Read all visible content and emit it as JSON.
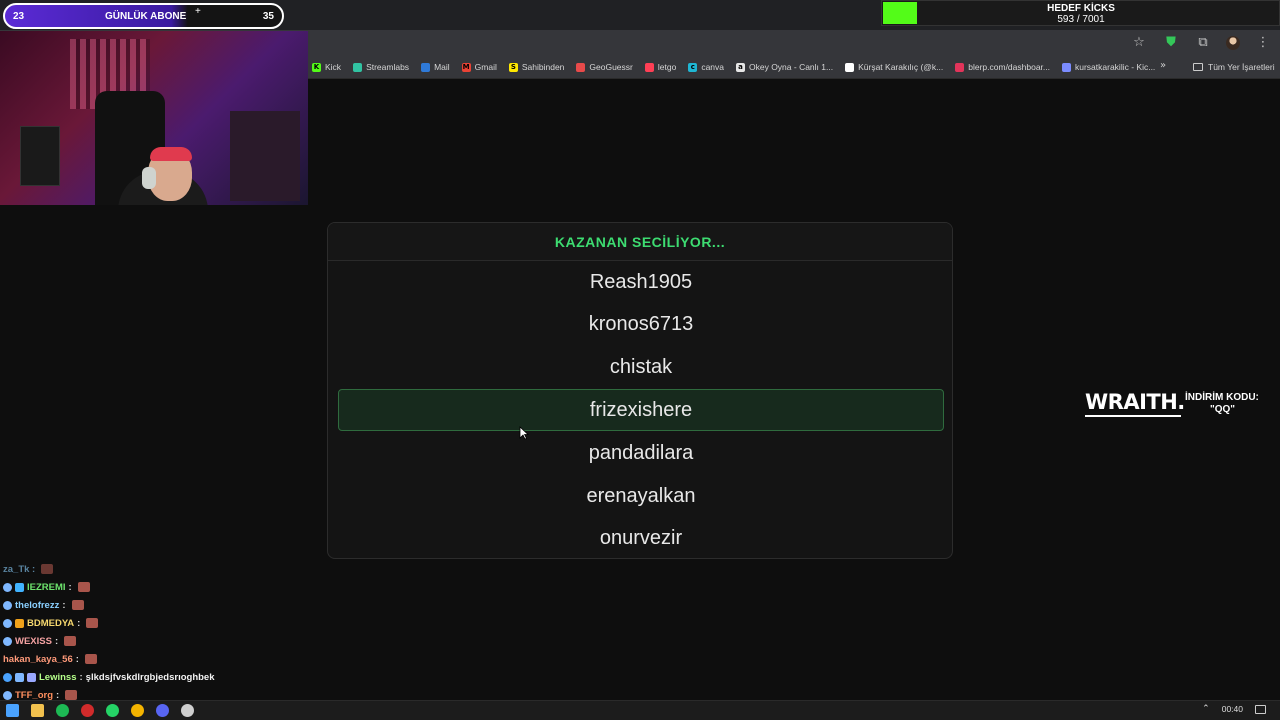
{
  "subscriber_bar": {
    "start": "23",
    "label": "GÜNLÜK ABONE",
    "plus": "+",
    "end": "35",
    "fill_fraction": 0.66
  },
  "kick_goal": {
    "title": "HEDEF KİCKS",
    "count": "593 / 7001",
    "progress_fraction": 0.0847,
    "bar_color": "#53fc18"
  },
  "bookmarks": {
    "items": [
      {
        "label": "Kick",
        "icon": "kick-icon",
        "color": "#53fc18",
        "glyph": "K"
      },
      {
        "label": "Streamlabs",
        "icon": "streamlabs-icon",
        "color": "#31c3a2",
        "glyph": ""
      },
      {
        "label": "Mail",
        "icon": "mail-icon",
        "color": "#2f7ad8",
        "glyph": ""
      },
      {
        "label": "Gmail",
        "icon": "gmail-icon",
        "color": "#ea4335",
        "glyph": "M"
      },
      {
        "label": "Sahibinden",
        "icon": "sahibinden-icon",
        "color": "#ffe800",
        "glyph": "S"
      },
      {
        "label": "GeoGuessr",
        "icon": "geoguessr-icon",
        "color": "#e84a4a",
        "glyph": ""
      },
      {
        "label": "letgo",
        "icon": "letgo-icon",
        "color": "#ff3f55",
        "glyph": ""
      },
      {
        "label": "canva",
        "icon": "canva-icon",
        "color": "#1fb6d3",
        "glyph": "c"
      },
      {
        "label": "Okey Oyna - Canlı 1...",
        "icon": "okey-icon",
        "color": "#e6e6e6",
        "glyph": "a"
      },
      {
        "label": "Kürşat Karakılıç (@k...",
        "icon": "tiktok-icon",
        "color": "#ffffff",
        "glyph": ""
      },
      {
        "label": "blerp.com/dashboar...",
        "icon": "blerp-icon",
        "color": "#e2345a",
        "glyph": ""
      },
      {
        "label": "kursatkarakilic - Kic...",
        "icon": "kick-alt-icon",
        "color": "#7b8cff",
        "glyph": ""
      }
    ],
    "more": "»",
    "all_label": "Tüm Yer İşaretleri"
  },
  "picker": {
    "title": "KAZANAN SECİLİYOR...",
    "title_color": "#3ddc71",
    "names": [
      "Reash1905",
      "kronos6713",
      "chistak",
      "frizexishere",
      "pandadilara",
      "erenayalkan",
      "onurvezir"
    ],
    "selected_index": 3
  },
  "promo": {
    "brand": "WRAITH.",
    "label": "İNDİRİM KODU:",
    "code": "\"QQ\""
  },
  "chat": {
    "partial_top": "za_Tk :",
    "lines": [
      {
        "user": "IEZREMI",
        "color": "#6de36d",
        "msg": "",
        "badges": [
          "#7fb8ff",
          "#41b3ff"
        ]
      },
      {
        "user": "thelofrezz",
        "color": "#8ad0ff",
        "msg": "",
        "badges": [
          "#7fb8ff"
        ]
      },
      {
        "user": "BDMEDYA",
        "color": "#f5d76e",
        "msg": "",
        "badges": [
          "#7fb8ff",
          "#f0a21a"
        ]
      },
      {
        "user": "WEXISS",
        "color": "#f5a3a3",
        "msg": "",
        "badges": [
          "#7fb8ff"
        ]
      },
      {
        "user": "hakan_kaya_56",
        "color": "#ff9a7a",
        "msg": "",
        "badges": []
      },
      {
        "user": "Lewinss",
        "color": "#b5ff8a",
        "msg": "şlkdsjfvskdlrgbjedsrıoghbek",
        "badges": [
          "#4aa3ff",
          "#7fb8ff",
          "#9aa9ff"
        ]
      },
      {
        "user": "TFF_org",
        "color": "#ff8f5e",
        "msg": "",
        "badges": [
          "#7fb8ff"
        ]
      }
    ]
  },
  "taskbar": {
    "icons": [
      {
        "name": "windows-start-icon",
        "color": "#4aa3ff"
      },
      {
        "name": "file-explorer-icon",
        "color": "#f2c14e"
      },
      {
        "name": "spotify-icon",
        "color": "#1db954"
      },
      {
        "name": "opera-icon",
        "color": "#d12b2b"
      },
      {
        "name": "whatsapp-icon",
        "color": "#25d366"
      },
      {
        "name": "chrome-icon",
        "color": "#f4b400"
      },
      {
        "name": "discord-icon",
        "color": "#5865f2"
      },
      {
        "name": "obs-icon",
        "color": "#cfcfcf"
      }
    ],
    "time": "00:40"
  }
}
